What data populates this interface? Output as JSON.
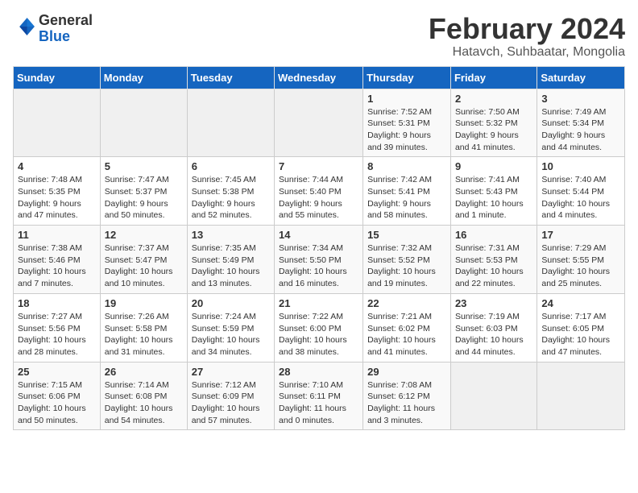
{
  "header": {
    "logo_general": "General",
    "logo_blue": "Blue",
    "month_title": "February 2024",
    "subtitle": "Hatavch, Suhbaatar, Mongolia"
  },
  "days_of_week": [
    "Sunday",
    "Monday",
    "Tuesday",
    "Wednesday",
    "Thursday",
    "Friday",
    "Saturday"
  ],
  "weeks": [
    [
      {
        "day": "",
        "info": ""
      },
      {
        "day": "",
        "info": ""
      },
      {
        "day": "",
        "info": ""
      },
      {
        "day": "",
        "info": ""
      },
      {
        "day": "1",
        "info": "Sunrise: 7:52 AM\nSunset: 5:31 PM\nDaylight: 9 hours and 39 minutes."
      },
      {
        "day": "2",
        "info": "Sunrise: 7:50 AM\nSunset: 5:32 PM\nDaylight: 9 hours and 41 minutes."
      },
      {
        "day": "3",
        "info": "Sunrise: 7:49 AM\nSunset: 5:34 PM\nDaylight: 9 hours and 44 minutes."
      }
    ],
    [
      {
        "day": "4",
        "info": "Sunrise: 7:48 AM\nSunset: 5:35 PM\nDaylight: 9 hours and 47 minutes."
      },
      {
        "day": "5",
        "info": "Sunrise: 7:47 AM\nSunset: 5:37 PM\nDaylight: 9 hours and 50 minutes."
      },
      {
        "day": "6",
        "info": "Sunrise: 7:45 AM\nSunset: 5:38 PM\nDaylight: 9 hours and 52 minutes."
      },
      {
        "day": "7",
        "info": "Sunrise: 7:44 AM\nSunset: 5:40 PM\nDaylight: 9 hours and 55 minutes."
      },
      {
        "day": "8",
        "info": "Sunrise: 7:42 AM\nSunset: 5:41 PM\nDaylight: 9 hours and 58 minutes."
      },
      {
        "day": "9",
        "info": "Sunrise: 7:41 AM\nSunset: 5:43 PM\nDaylight: 10 hours and 1 minute."
      },
      {
        "day": "10",
        "info": "Sunrise: 7:40 AM\nSunset: 5:44 PM\nDaylight: 10 hours and 4 minutes."
      }
    ],
    [
      {
        "day": "11",
        "info": "Sunrise: 7:38 AM\nSunset: 5:46 PM\nDaylight: 10 hours and 7 minutes."
      },
      {
        "day": "12",
        "info": "Sunrise: 7:37 AM\nSunset: 5:47 PM\nDaylight: 10 hours and 10 minutes."
      },
      {
        "day": "13",
        "info": "Sunrise: 7:35 AM\nSunset: 5:49 PM\nDaylight: 10 hours and 13 minutes."
      },
      {
        "day": "14",
        "info": "Sunrise: 7:34 AM\nSunset: 5:50 PM\nDaylight: 10 hours and 16 minutes."
      },
      {
        "day": "15",
        "info": "Sunrise: 7:32 AM\nSunset: 5:52 PM\nDaylight: 10 hours and 19 minutes."
      },
      {
        "day": "16",
        "info": "Sunrise: 7:31 AM\nSunset: 5:53 PM\nDaylight: 10 hours and 22 minutes."
      },
      {
        "day": "17",
        "info": "Sunrise: 7:29 AM\nSunset: 5:55 PM\nDaylight: 10 hours and 25 minutes."
      }
    ],
    [
      {
        "day": "18",
        "info": "Sunrise: 7:27 AM\nSunset: 5:56 PM\nDaylight: 10 hours and 28 minutes."
      },
      {
        "day": "19",
        "info": "Sunrise: 7:26 AM\nSunset: 5:58 PM\nDaylight: 10 hours and 31 minutes."
      },
      {
        "day": "20",
        "info": "Sunrise: 7:24 AM\nSunset: 5:59 PM\nDaylight: 10 hours and 34 minutes."
      },
      {
        "day": "21",
        "info": "Sunrise: 7:22 AM\nSunset: 6:00 PM\nDaylight: 10 hours and 38 minutes."
      },
      {
        "day": "22",
        "info": "Sunrise: 7:21 AM\nSunset: 6:02 PM\nDaylight: 10 hours and 41 minutes."
      },
      {
        "day": "23",
        "info": "Sunrise: 7:19 AM\nSunset: 6:03 PM\nDaylight: 10 hours and 44 minutes."
      },
      {
        "day": "24",
        "info": "Sunrise: 7:17 AM\nSunset: 6:05 PM\nDaylight: 10 hours and 47 minutes."
      }
    ],
    [
      {
        "day": "25",
        "info": "Sunrise: 7:15 AM\nSunset: 6:06 PM\nDaylight: 10 hours and 50 minutes."
      },
      {
        "day": "26",
        "info": "Sunrise: 7:14 AM\nSunset: 6:08 PM\nDaylight: 10 hours and 54 minutes."
      },
      {
        "day": "27",
        "info": "Sunrise: 7:12 AM\nSunset: 6:09 PM\nDaylight: 10 hours and 57 minutes."
      },
      {
        "day": "28",
        "info": "Sunrise: 7:10 AM\nSunset: 6:11 PM\nDaylight: 11 hours and 0 minutes."
      },
      {
        "day": "29",
        "info": "Sunrise: 7:08 AM\nSunset: 6:12 PM\nDaylight: 11 hours and 3 minutes."
      },
      {
        "day": "",
        "info": ""
      },
      {
        "day": "",
        "info": ""
      }
    ]
  ]
}
